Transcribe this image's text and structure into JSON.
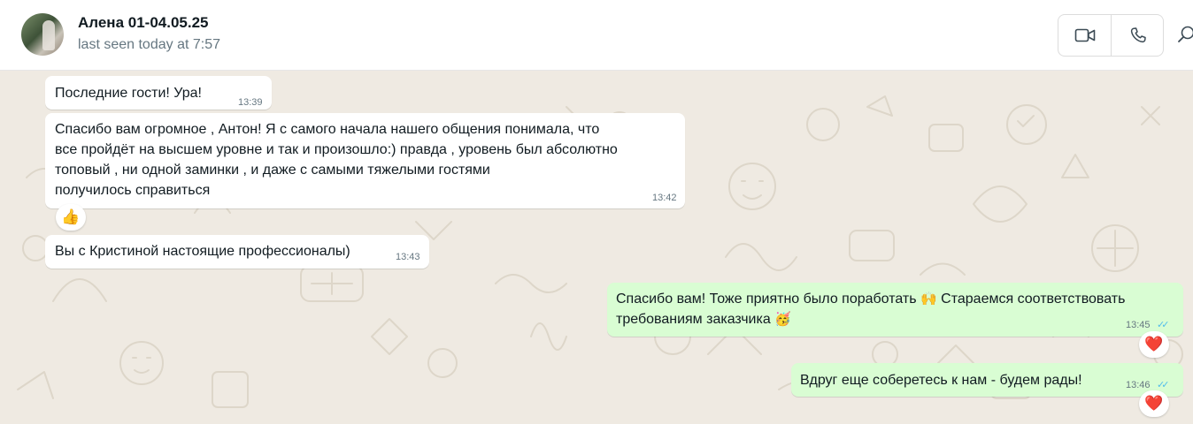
{
  "contact": {
    "name": "Алена 01-04.05.25",
    "status": "last seen today at 7:57"
  },
  "icons": {
    "video": "video-camera-icon",
    "voice": "phone-icon",
    "search": "search-icon"
  },
  "messages": [
    {
      "direction": "in",
      "text": "Последние гости! Ура!",
      "time": "13:39"
    },
    {
      "direction": "in",
      "text": "Спасибо вам огромное , Антон! Я с самого начала нашего общения понимала, что\nвсе пройдёт на высшем уровне и так и произошло:) правда , уровень был абсолютно\nтоповый , ни одной заминки , и даже с  самыми тяжелыми гостями\nполучилось справиться",
      "time": "13:42",
      "reaction": "👍"
    },
    {
      "direction": "in",
      "text": "Вы с Кристиной настоящие профессионалы)",
      "time": "13:43"
    },
    {
      "direction": "out",
      "text_line1": "Спасибо вам! Тоже приятно было поработать ",
      "emoji1": "🙌",
      "text_line1b": " Стараемся соответствовать",
      "text_line2": "требованиям заказчика ",
      "emoji2": "🥳",
      "time": "13:45",
      "status": "read",
      "reaction": "❤️"
    },
    {
      "direction": "out",
      "text": "Вдруг еще соберетесь к нам - будем рады!",
      "time": "13:46",
      "status": "read",
      "reaction": "❤️"
    }
  ],
  "colors": {
    "wallpaper": "#efeae2",
    "incoming": "#ffffff",
    "outgoing": "#d9fdd3",
    "read_ticks": "#53bdeb",
    "muted_text": "#667781"
  }
}
